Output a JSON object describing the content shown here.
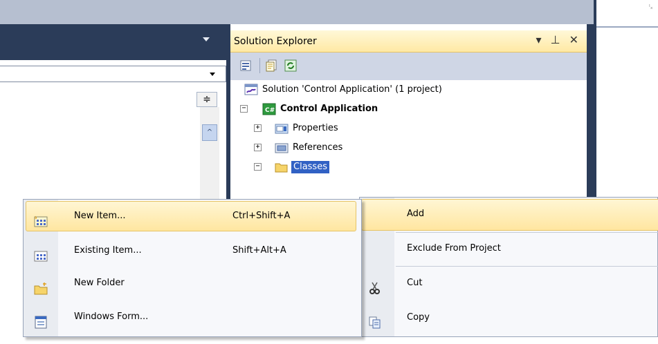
{
  "solution_explorer": {
    "title": "Solution Explorer",
    "title_buttons": "▾ ⊥ ✕",
    "toolbar": [
      "properties-icon",
      "show-all-files-icon",
      "refresh-icon"
    ],
    "tree": [
      {
        "label": "Solution 'Control Application' (1 project)",
        "icon": "solution-icon",
        "expander": ""
      },
      {
        "label": "Control Application",
        "icon": "csharp-project-icon",
        "expander": "−",
        "bold": true
      },
      {
        "label": "Properties",
        "icon": "properties-folder-icon",
        "expander": "+"
      },
      {
        "label": "References",
        "icon": "references-icon",
        "expander": "+"
      },
      {
        "label": "Classes",
        "icon": "folder-open-icon",
        "expander": "−",
        "selected": true
      }
    ]
  },
  "editor": {
    "split_glyph": "≑",
    "scroll_up_glyph": "^"
  },
  "right_panel": {
    "glyph": "ᴵₓ"
  },
  "context_menu": {
    "items": [
      {
        "label": "Add",
        "icon": "",
        "highlighted": true
      },
      {
        "label": "Exclude From Project",
        "icon": ""
      },
      {
        "label": "Cut",
        "icon": "scissors-icon"
      },
      {
        "label": "Copy",
        "icon": "copy-icon"
      }
    ]
  },
  "add_submenu": {
    "items": [
      {
        "label": "New Item...",
        "shortcut": "Ctrl+Shift+A",
        "icon": "new-item-icon",
        "highlighted": true
      },
      {
        "label": "Existing Item...",
        "shortcut": "Shift+Alt+A",
        "icon": "existing-item-icon"
      },
      {
        "label": "New Folder",
        "shortcut": "",
        "icon": "new-folder-icon"
      },
      {
        "label": "Windows Form...",
        "shortcut": "",
        "icon": "windows-form-icon"
      }
    ]
  },
  "colors": {
    "ide_dark": "#2b3c59",
    "title_gold": "#ffe9a4",
    "highlight": "#ffe6a0",
    "menu_bg": "#f7f8fb"
  }
}
